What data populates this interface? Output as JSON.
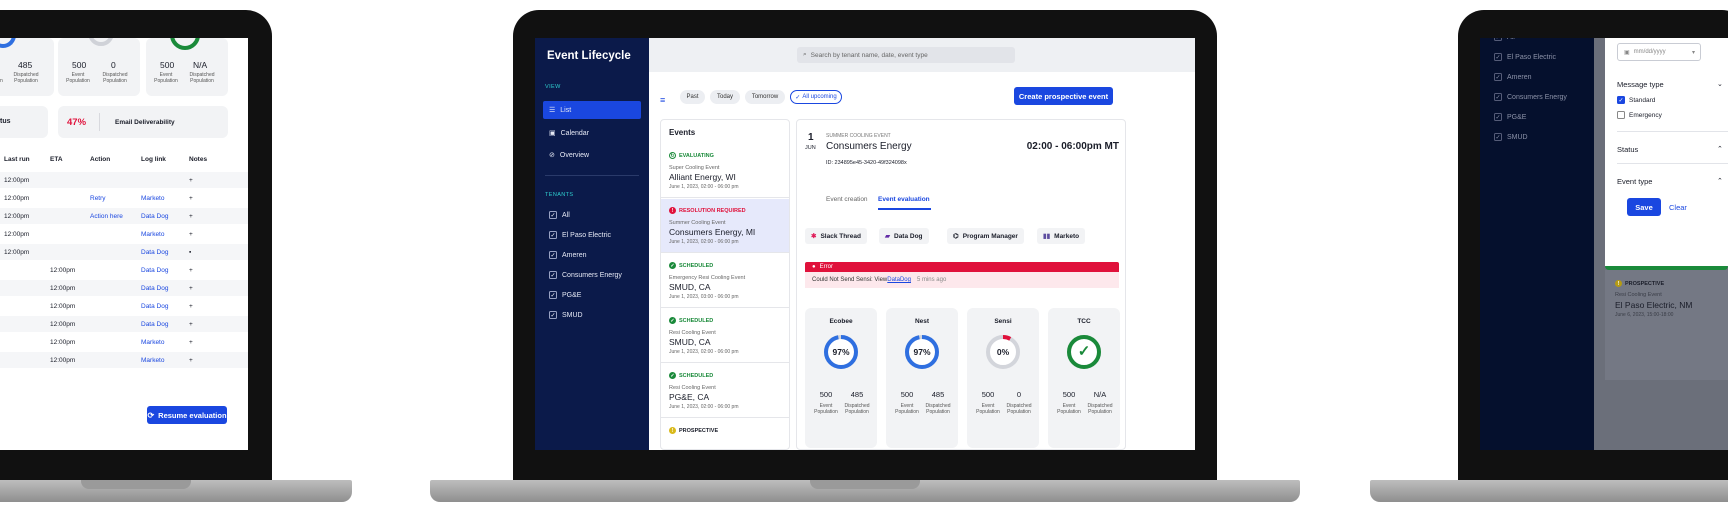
{
  "left": {
    "stats": [
      {
        "value": "485",
        "label1": "Dispatched",
        "label2": "Population"
      },
      {
        "value": "500",
        "label1": "Event",
        "label2": "Population"
      },
      {
        "value": "0",
        "label1": "Dispatched",
        "label2": "Population"
      },
      {
        "value": "500",
        "label1": "Event",
        "label2": "Population"
      },
      {
        "value": "N/A",
        "label1": "Dispatched",
        "label2": "Population"
      }
    ],
    "partial_label_n": "n",
    "status_label": "tus",
    "email_pct": "47%",
    "email_label": "Email Deliverability",
    "headers": [
      "Last run",
      "ETA",
      "Action",
      "Log link",
      "Notes"
    ],
    "rows": [
      {
        "last": "12:00pm",
        "eta": "",
        "action": "",
        "log": "",
        "note": "+"
      },
      {
        "last": "12:00pm",
        "eta": "",
        "action": "Retry",
        "log": "Marketo",
        "note": "+"
      },
      {
        "last": "12:00pm",
        "eta": "",
        "action": "Action here",
        "log": "Data Dog",
        "note": "+"
      },
      {
        "last": "12:00pm",
        "eta": "",
        "action": "",
        "log": "Marketo",
        "note": "+"
      },
      {
        "last": "12:00pm",
        "eta": "",
        "action": "",
        "log": "Data Dog",
        "note": "▪"
      },
      {
        "last": "",
        "eta": "12:00pm",
        "action": "",
        "log": "Data Dog",
        "note": "+"
      },
      {
        "last": "",
        "eta": "12:00pm",
        "action": "",
        "log": "Data Dog",
        "note": "+"
      },
      {
        "last": "",
        "eta": "12:00pm",
        "action": "",
        "log": "Data Dog",
        "note": "+"
      },
      {
        "last": "",
        "eta": "12:00pm",
        "action": "",
        "log": "Data Dog",
        "note": "+"
      },
      {
        "last": "",
        "eta": "12:00pm",
        "action": "",
        "log": "Marketo",
        "note": "+"
      },
      {
        "last": "",
        "eta": "12:00pm",
        "action": "",
        "log": "Marketo",
        "note": "+"
      }
    ],
    "resume_label": "Resume evaluation"
  },
  "center": {
    "app_title": "Event Lifecycle",
    "search_placeholder": "Search by tenant name, date, event type",
    "view_label": "VIEW",
    "view_items": [
      "List",
      "Calendar",
      "Overview"
    ],
    "tenants_label": "TENANTS",
    "tenants": [
      "All",
      "El Paso Electric",
      "Ameren",
      "Consumers Energy",
      "PG&E",
      "SMUD"
    ],
    "filters": [
      "Past",
      "Today",
      "Tomorrow",
      "All upcoming"
    ],
    "create_label": "Create prospective event",
    "events_title": "Events",
    "events": [
      {
        "status": "EVALUATING",
        "type": "Super Cooling Event",
        "name": "Alliant Energy, WI",
        "date": "June 1, 2023, 02:00 - 06:00 pm"
      },
      {
        "status": "RESOLUTION REQUIRED",
        "type": "Summer Cooling Event",
        "name": "Consumers Energy, MI",
        "date": "June 1, 2023, 02:00 - 06:00 pm"
      },
      {
        "status": "SCHEDULED",
        "type": "Emergency Resi Cooling Event",
        "name": "SMUD, CA",
        "date": "June 1, 2023, 03:00 - 06:00 pm"
      },
      {
        "status": "SCHEDULED",
        "type": "Resi Cooling Event",
        "name": "SMUD, CA",
        "date": "June 1, 2023, 02:00 - 06:00 pm"
      },
      {
        "status": "SCHEDULED",
        "type": "Resi Cooling Event",
        "name": "PG&E, CA",
        "date": "June 1, 2023, 02:00 - 06:00 pm"
      },
      {
        "status": "PROSPECTIVE",
        "type": "",
        "name": "",
        "date": ""
      }
    ],
    "detail": {
      "day": "1",
      "month": "JUN",
      "kind": "SUMMER COOLING EVENT",
      "name": "Consumers Energy",
      "time": "02:00 - 06:00pm MT",
      "id": "ID: 234895e45-3420-49f324098x",
      "tabs": [
        "Event creation",
        "Event evaluation"
      ],
      "tools": [
        "Slack Thread",
        "Data Dog",
        "Program Manager",
        "Marketo"
      ],
      "error_title": "Error",
      "error_prefix": "Could Not Send Sensi: View ",
      "error_link": "DataDog",
      "error_time": "5 mins ago",
      "devices": [
        {
          "name": "Ecobee",
          "pct": "97%",
          "event": "500",
          "dispatched": "485",
          "fraction": 0.97,
          "color": "#2f6fe0"
        },
        {
          "name": "Nest",
          "pct": "97%",
          "event": "500",
          "dispatched": "485",
          "fraction": 0.97,
          "color": "#2f6fe0"
        },
        {
          "name": "Sensi",
          "pct": "0%",
          "event": "500",
          "dispatched": "0",
          "fraction": 0.0,
          "color": "#e0113b"
        },
        {
          "name": "TCC",
          "pct": "",
          "event": "500",
          "dispatched": "N/A",
          "fraction": 1.0,
          "color": "#1a8a3a"
        }
      ],
      "event_l1": "Event",
      "event_l2": "Population",
      "disp_l1": "Dispatched",
      "disp_l2": "Population"
    }
  },
  "right": {
    "tenants": [
      "All",
      "El Paso Electric",
      "Ameren",
      "Consumers Energy",
      "PG&E",
      "SMUD"
    ],
    "date_placeholder": "mm/dd/yyyy",
    "message_type_label": "Message type",
    "options": [
      "Standard",
      "Emergency"
    ],
    "status_label": "Status",
    "event_type_label": "Event type",
    "save_label": "Save",
    "clear_label": "Clear",
    "prospective": {
      "status": "PROSPECTIVE",
      "type": "Resi Cooling Event",
      "name": "El Paso Electric, NM",
      "date": "June 6, 2023, 15:00-18:00"
    }
  }
}
